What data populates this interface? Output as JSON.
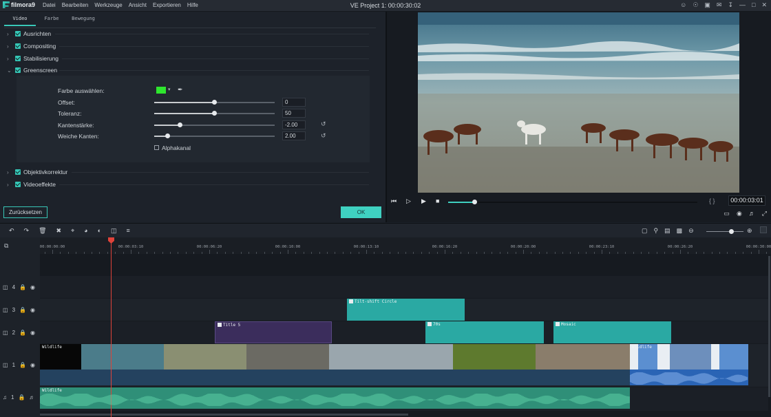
{
  "app": {
    "logo_text": "filmora9",
    "menu": [
      "Datei",
      "Bearbeiten",
      "Werkzeuge",
      "Ansicht",
      "Exportieren",
      "Hilfe"
    ],
    "project_title": "VE Project 1: 00:00:30:02",
    "window_icons": [
      "user-icon",
      "cart-icon",
      "save-icon",
      "mail-icon",
      "download-icon",
      "minimize-icon",
      "maximize-icon",
      "close-icon"
    ]
  },
  "editor": {
    "tabs": [
      "Video",
      "Farbe",
      "Bewegung"
    ],
    "active_tab": "Video",
    "sections_top": [
      {
        "label": "Ausrichten",
        "expanded": false
      },
      {
        "label": "Compositing",
        "expanded": false
      },
      {
        "label": "Stabilisierung",
        "expanded": false
      },
      {
        "label": "Greenscreen",
        "expanded": true
      }
    ],
    "greenscreen": {
      "color_label": "Farbe auswählen:",
      "color": "#2ee62e",
      "rows": [
        {
          "label": "Offset:",
          "value": "0",
          "level": 0.5,
          "reset": false
        },
        {
          "label": "Toleranz:",
          "value": "50",
          "level": 0.5,
          "reset": false
        },
        {
          "label": "Kantenstärke:",
          "value": "-2.00",
          "level": 0.2,
          "reset": true
        },
        {
          "label": "Weiche Kanten:",
          "value": "2.00",
          "level": 0.1,
          "reset": true
        }
      ],
      "alpha_label": "Alphakanal",
      "alpha_checked": false
    },
    "sections_bottom": [
      {
        "label": "Objektivkorrektur",
        "expanded": false
      },
      {
        "label": "Videoeffekte",
        "expanded": false
      }
    ],
    "reset_label": "Zurücksetzen",
    "ok_label": "OK"
  },
  "preview": {
    "timecode": "00:00:03:01",
    "progress": 0.1,
    "braces": "{ }"
  },
  "timeline": {
    "ruler_labels": [
      "00:00:00:00",
      "00:00:03:10",
      "00:00:06:20",
      "00:00:10:00",
      "00:00:13:10",
      "00:00:16:20",
      "00:00:20:00",
      "00:00:23:10",
      "00:00:26:20",
      "00:00:30:00"
    ],
    "tracks": [
      {
        "id": "4",
        "kind": "video"
      },
      {
        "id": "3",
        "kind": "video"
      },
      {
        "id": "2",
        "kind": "video"
      },
      {
        "id": "1",
        "kind": "video"
      },
      {
        "id": "1",
        "kind": "audio"
      }
    ],
    "clips": {
      "track3": "Tilt-shift Circle",
      "track2a": "Title 5",
      "track2b": "70s",
      "track2c": "Mosaic",
      "track1a": "Wildlife",
      "track1b": "Wildlife",
      "audio": "Wildlife"
    }
  },
  "colors": {
    "accent": "#3fd1c1",
    "title_clip": "#3b2d5c",
    "effect_clip": "#2aa9a3",
    "playhead": "#e0433a"
  }
}
